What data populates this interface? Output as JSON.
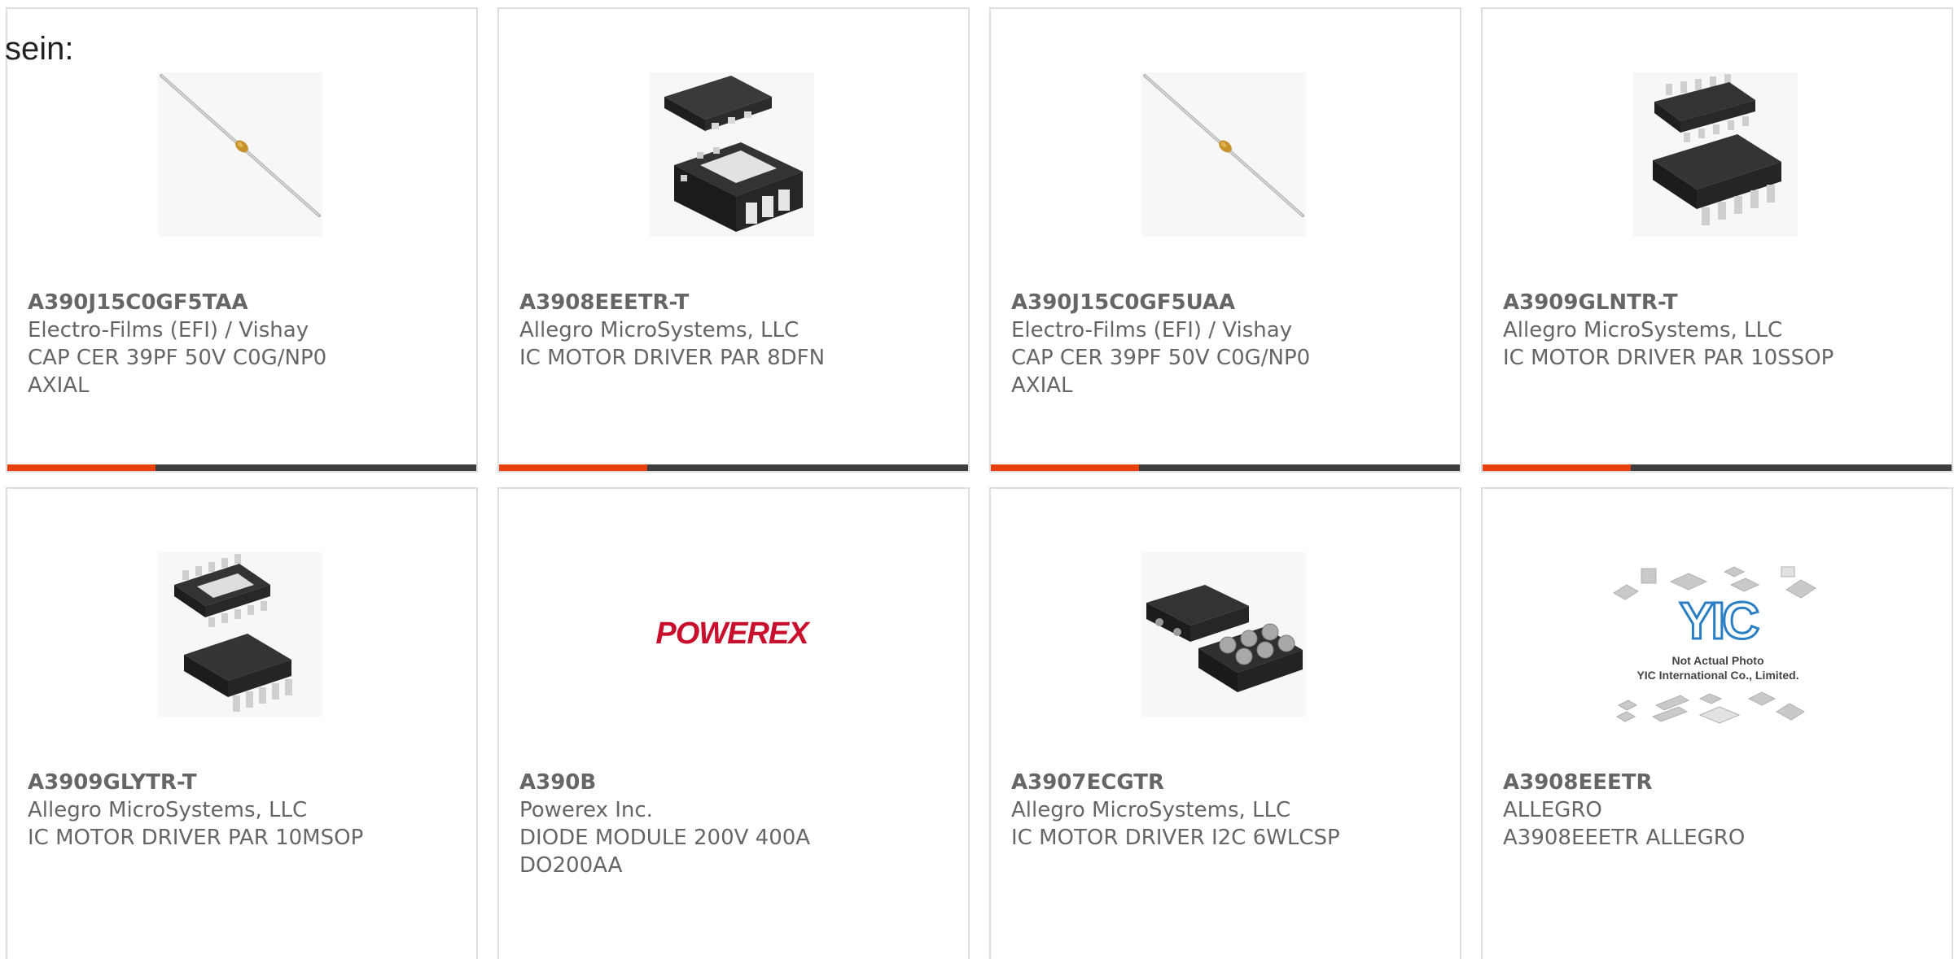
{
  "lead_text": "sein:",
  "products": [
    {
      "part_number": "A390J15C0GF5TAA",
      "manufacturer": "Electro-Films (EFI) / Vishay",
      "description_line1": "CAP CER 39PF 50V C0G/NP0",
      "description_line2": "AXIAL",
      "image_icon": "axial-capacitor-icon"
    },
    {
      "part_number": "A3908EEETR-T",
      "manufacturer": "Allegro MicroSystems, LLC",
      "description_line1": "IC MOTOR DRIVER PAR 8DFN",
      "description_line2": "",
      "image_icon": "dfn-chip-icon"
    },
    {
      "part_number": "A390J15C0GF5UAA",
      "manufacturer": "Electro-Films (EFI) / Vishay",
      "description_line1": "CAP CER 39PF 50V C0G/NP0",
      "description_line2": "AXIAL",
      "image_icon": "axial-capacitor-icon"
    },
    {
      "part_number": "A3909GLNTR-T",
      "manufacturer": "Allegro MicroSystems, LLC",
      "description_line1": "IC MOTOR DRIVER PAR 10SSOP",
      "description_line2": "",
      "image_icon": "ssop-chip-icon"
    },
    {
      "part_number": "A3909GLYTR-T",
      "manufacturer": "Allegro MicroSystems, LLC",
      "description_line1": "IC MOTOR DRIVER PAR 10MSOP",
      "description_line2": "",
      "image_icon": "msop-chip-icon"
    },
    {
      "part_number": "A390B",
      "manufacturer": "Powerex Inc.",
      "description_line1": "DIODE MODULE 200V 400A",
      "description_line2": "DO200AA",
      "image_icon": "powerex-logo",
      "image_text": "POWEREX"
    },
    {
      "part_number": "A3907ECGTR",
      "manufacturer": "Allegro MicroSystems, LLC",
      "description_line1": "IC MOTOR DRIVER I2C 6WLCSP",
      "description_line2": "",
      "image_icon": "wlcsp-chip-icon"
    },
    {
      "part_number": "A3908EEETR",
      "manufacturer": "ALLEGRO",
      "description_line1": "A3908EEETR ALLEGRO",
      "description_line2": "",
      "image_icon": "yic-placeholder-icon",
      "image_text_1": "YIC",
      "image_text_2": "Not Actual Photo",
      "image_text_3": "YIC International Co., Limited."
    }
  ],
  "colors": {
    "accent": "#e8410e",
    "bar_dark": "#3d3d3d",
    "text": "#666666",
    "border": "#dedede",
    "powerex_red": "#c8102e",
    "yic_blue": "#2a7fc4"
  }
}
